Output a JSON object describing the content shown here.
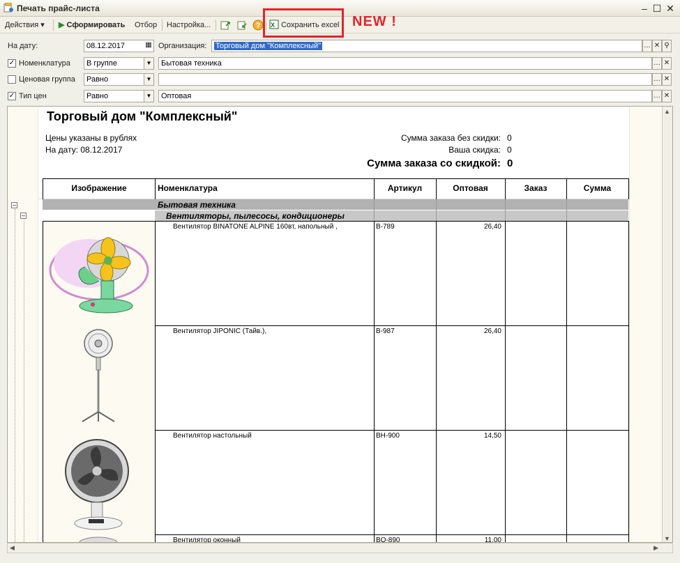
{
  "window": {
    "title": "Печать прайс-листа"
  },
  "toolbar": {
    "actions": "Действия",
    "generate": "Сформировать",
    "filter": "Отбор",
    "settings": "Настройка...",
    "save_excel": "Сохранить excel",
    "new_label": "NEW !"
  },
  "form": {
    "date_label": "На дату:",
    "date_value": "08.12.2017",
    "org_label": "Организация:",
    "org_value": "Торговый дом \"Комплексный\"",
    "nom_label": "Номенклатура",
    "nom_cond": "В группе",
    "nom_value": "Бытовая техника",
    "price_group_label": "Ценовая группа",
    "price_group_cond": "Равно",
    "price_group_value": "",
    "price_type_label": "Тип цен",
    "price_type_cond": "Равно",
    "price_type_value": "Оптовая"
  },
  "report": {
    "title": "Торговый дом \"Комплексный\"",
    "currency_note": "Цены указаны в рублях",
    "date_note": "На дату: 08.12.2017",
    "sum_no_discount_label": "Сумма заказа без скидки:",
    "sum_no_discount_value": "0",
    "discount_label": "Ваша скидка:",
    "discount_value": "0",
    "sum_discount_label": "Сумма заказа со скидкой:",
    "sum_discount_value": "0",
    "columns": [
      "Изображение",
      "Номенклатура",
      "Артикул",
      "Оптовая",
      "Заказ",
      "Сумма"
    ],
    "group": "Бытовая техника",
    "subgroup": "Вентиляторы, пылесосы, кондиционеры",
    "rows": [
      {
        "name": "Вентилятор BINATONE ALPINE 160вт, напольный ,",
        "sku": "B-789",
        "price": "26,40"
      },
      {
        "name": "Вентилятор JIPONIC (Тайв.),",
        "sku": "B-987",
        "price": "26,40"
      },
      {
        "name": "Вентилятор настольный",
        "sku": "BH-900",
        "price": "14,50"
      },
      {
        "name": "Вентилятор оконный",
        "sku": "BO-890",
        "price": "11,00"
      }
    ]
  },
  "colors": {
    "accent_red": "#e2242b",
    "group_gray": "#b2b2b2",
    "generate_green": "#2a8a2a"
  },
  "icons": [
    "app-icon",
    "minimize-icon",
    "maximize-icon",
    "close-icon",
    "play-icon",
    "excel-icon",
    "help-icon",
    "calendar-icon",
    "search-icon"
  ]
}
